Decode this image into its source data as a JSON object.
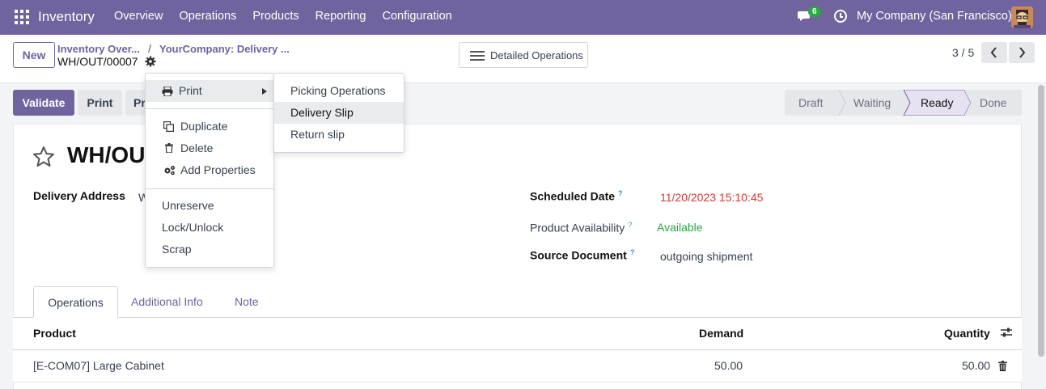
{
  "navbar": {
    "app_name": "Inventory",
    "menu": [
      "Overview",
      "Operations",
      "Products",
      "Reporting",
      "Configuration"
    ],
    "message_count": "6",
    "company": "My Company (San Francisco)",
    "color": "#71639e"
  },
  "control_panel": {
    "new_label": "New",
    "breadcrumb": [
      "Inventory Over...",
      "YourCompany: Delivery ..."
    ],
    "breadcrumb_sep": "/",
    "record_name": "WH/OUT/00007",
    "detailed_ops_label": "Detailed Operations",
    "pager": "3 / 5"
  },
  "actions": {
    "validate_label": "Validate",
    "print_label": "Print",
    "partial_label": "Pr"
  },
  "statusbar": {
    "stages": [
      "Draft",
      "Waiting",
      "Ready",
      "Done"
    ],
    "active": "Ready"
  },
  "form": {
    "title": "WH/OU",
    "delivery_address_label": "Delivery Address",
    "delivery_address_value": "W",
    "scheduled_date_label": "Scheduled Date",
    "scheduled_date_value": "11/20/2023 15:10:45",
    "availability_label": "Product Availability",
    "availability_value": "Available",
    "source_doc_label": "Source Document",
    "source_doc_value": "outgoing shipment",
    "help_mark": "?"
  },
  "tabs": [
    "Operations",
    "Additional Info",
    "Note"
  ],
  "table": {
    "columns": [
      "Product",
      "Demand",
      "Quantity"
    ],
    "rows": [
      {
        "product": "[E-COM07] Large Cabinet",
        "demand": "50.00",
        "quantity": "50.00"
      }
    ]
  },
  "gear_menu": {
    "print_label": "Print",
    "items_group1": [
      "Duplicate",
      "Delete",
      "Add Properties"
    ],
    "items_group2": [
      "Unreserve",
      "Lock/Unlock",
      "Scrap"
    ]
  },
  "print_submenu": {
    "items": [
      "Picking Operations",
      "Delivery Slip",
      "Return slip"
    ],
    "highlighted": "Delivery Slip"
  }
}
